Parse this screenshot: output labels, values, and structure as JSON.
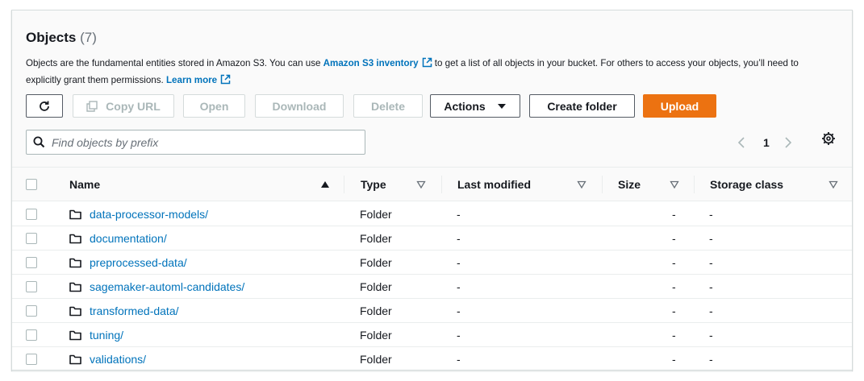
{
  "objects": {
    "title": "Objects",
    "count": "(7)",
    "description": {
      "part1": "Objects are the fundamental entities stored in Amazon S3. You can use ",
      "link1": "Amazon S3 inventory",
      "part2": " to get a list of all objects in your bucket. For others to access your objects, you’ll need to explicitly grant them permissions. ",
      "link2": "Learn more"
    }
  },
  "toolbar": {
    "copy_url": "Copy URL",
    "open": "Open",
    "download": "Download",
    "delete": "Delete",
    "actions": "Actions",
    "create_folder": "Create folder",
    "upload": "Upload"
  },
  "search": {
    "placeholder": "Find objects by prefix"
  },
  "pagination": {
    "current_page": "1"
  },
  "columns": {
    "name": "Name",
    "type": "Type",
    "last_modified": "Last modified",
    "size": "Size",
    "storage_class": "Storage class"
  },
  "rows": [
    {
      "name": "data-processor-models/",
      "type": "Folder",
      "last_modified": "-",
      "size": "-",
      "storage_class": "-"
    },
    {
      "name": "documentation/",
      "type": "Folder",
      "last_modified": "-",
      "size": "-",
      "storage_class": "-"
    },
    {
      "name": "preprocessed-data/",
      "type": "Folder",
      "last_modified": "-",
      "size": "-",
      "storage_class": "-"
    },
    {
      "name": "sagemaker-automl-candidates/",
      "type": "Folder",
      "last_modified": "-",
      "size": "-",
      "storage_class": "-"
    },
    {
      "name": "transformed-data/",
      "type": "Folder",
      "last_modified": "-",
      "size": "-",
      "storage_class": "-"
    },
    {
      "name": "tuning/",
      "type": "Folder",
      "last_modified": "-",
      "size": "-",
      "storage_class": "-"
    },
    {
      "name": "validations/",
      "type": "Folder",
      "last_modified": "-",
      "size": "-",
      "storage_class": "-"
    }
  ],
  "colors": {
    "link": "#0073bb",
    "primary": "#ec7211",
    "border": "#eaeded",
    "disabled": "#aab7b8"
  }
}
